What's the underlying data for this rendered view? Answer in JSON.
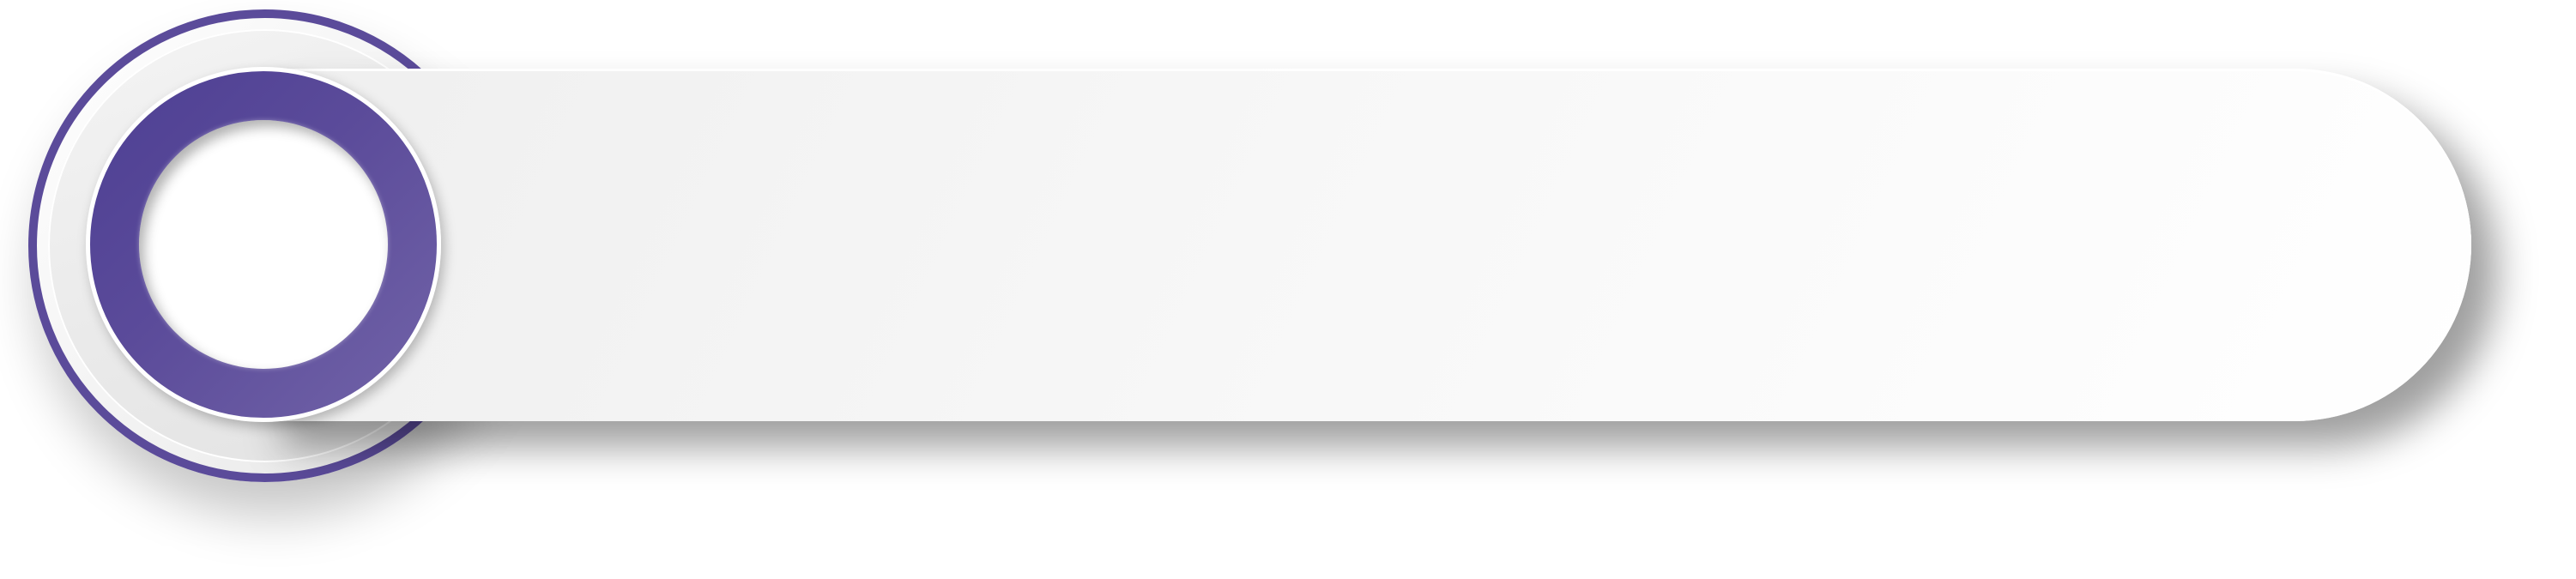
{
  "colors": {
    "accent": "#5b4b9a",
    "accent_dark": "#4d3f93",
    "accent_light": "#7264a8",
    "bar_fill": "#f7f7f7",
    "background": "#ffffff"
  },
  "shapes": {
    "outer_ring": "thin-purple-ring",
    "badge": "purple-donut",
    "bar": "white-pill-banner"
  }
}
